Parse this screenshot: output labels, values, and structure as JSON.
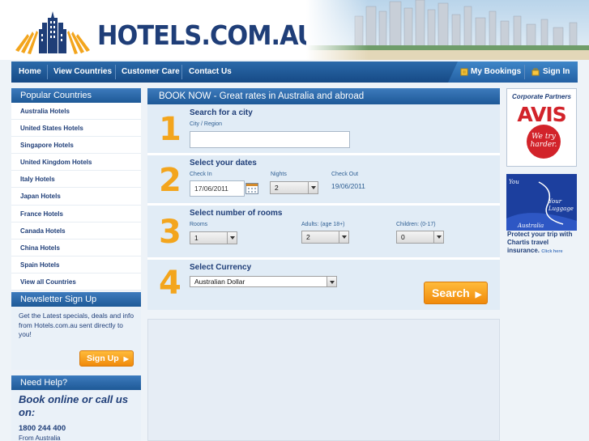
{
  "header": {
    "logo_text": "HOTELS.COM.AU"
  },
  "nav": {
    "items": [
      "Home",
      "View Countries",
      "Customer Care",
      "Contact Us"
    ],
    "my_bookings": "My Bookings",
    "sign_in": "Sign In"
  },
  "sidebar": {
    "popular_title": "Popular Countries",
    "countries": [
      "Australia Hotels",
      "United States Hotels",
      "Singapore Hotels",
      "United Kingdom Hotels",
      "Italy Hotels",
      "Japan Hotels",
      "France Hotels",
      "Canada Hotels",
      "China Hotels",
      "Spain Hotels",
      "View all Countries"
    ],
    "newsletter_title": "Newsletter Sign Up",
    "newsletter_text": "Get the Latest specials, deals and info from Hotels.com.au sent directly to you!",
    "signup_label": "Sign Up",
    "help_title": "Need Help?",
    "help_heading": "Book online or call us on:",
    "phone": "1800 244 400",
    "phone_note": "From Australia"
  },
  "booking": {
    "title": "BOOK NOW - Great rates in Australia and abroad",
    "step1": {
      "num": "1",
      "title": "Search for a city",
      "label": "City / Region",
      "value": ""
    },
    "step2": {
      "num": "2",
      "title": "Select your dates",
      "checkin_label": "Check In",
      "checkin_value": "17/06/2011",
      "nights_label": "Nights",
      "nights_value": "2",
      "checkout_label": "Check Out",
      "checkout_value": "19/06/2011"
    },
    "step3": {
      "num": "3",
      "title": "Select number of rooms",
      "rooms_label": "Rooms",
      "rooms_value": "1",
      "adults_label": "Adults: (age 18+)",
      "adults_value": "2",
      "children_label": "Children: (0-17)",
      "children_value": "0"
    },
    "step4": {
      "num": "4",
      "title": "Select Currency",
      "currency_value": "Australian Dollar"
    },
    "search_label": "Search"
  },
  "ads": {
    "avis_header": "Corporate Partners",
    "avis_brand": "AVIS",
    "avis_tagline": "We try harder.",
    "chartis_text1": "You",
    "chartis_text2": "Your Luggage",
    "chartis_text3": "Australia",
    "chartis_caption": "Protect your trip with Chartis travel insurance.",
    "chartis_link": "Click here"
  },
  "colors": {
    "brand_navy": "#1f3e78",
    "nav_blue": "#1e5997",
    "accent_orange": "#f3a51d",
    "avis_red": "#d2232a"
  }
}
